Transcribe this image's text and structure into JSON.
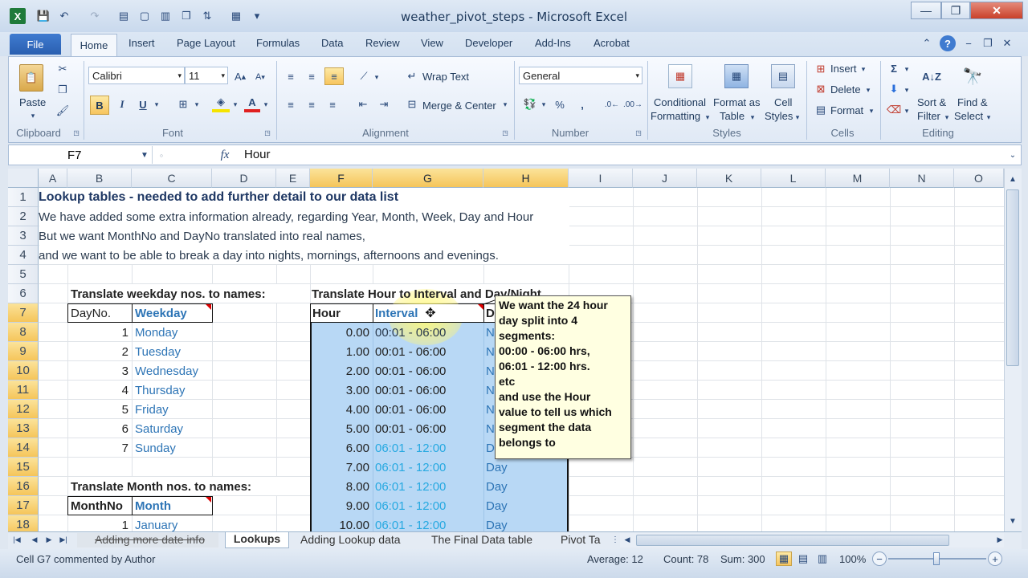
{
  "window": {
    "title": "weather_pivot_steps  -  Microsoft Excel"
  },
  "ribbon": {
    "tabs": [
      "File",
      "Home",
      "Insert",
      "Page Layout",
      "Formulas",
      "Data",
      "Review",
      "View",
      "Developer",
      "Add-Ins",
      "Acrobat"
    ],
    "clipboard": {
      "paste": "Paste",
      "group": "Clipboard"
    },
    "font": {
      "name": "Calibri",
      "size": "11",
      "bold": "B",
      "italic": "I",
      "underline": "U",
      "group": "Font"
    },
    "alignment": {
      "wrap": "Wrap Text",
      "merge": "Merge & Center",
      "group": "Alignment"
    },
    "number": {
      "format": "General",
      "percent": "%",
      "comma": ",",
      "group": "Number"
    },
    "styles": {
      "conditional1": "Conditional",
      "conditional2": "Formatting",
      "format_table1": "Format as",
      "format_table2": "Table",
      "cell_styles1": "Cell",
      "cell_styles2": "Styles",
      "group": "Styles"
    },
    "cells": {
      "insert": "Insert",
      "delete": "Delete",
      "format": "Format",
      "group": "Cells"
    },
    "editing": {
      "sort1": "Sort &",
      "sort2": "Filter",
      "find1": "Find &",
      "find2": "Select",
      "sigma": "Σ",
      "group": "Editing"
    }
  },
  "formula_bar": {
    "name_box": "F7",
    "fx": "fx",
    "content": "Hour"
  },
  "columns": [
    "A",
    "B",
    "C",
    "D",
    "E",
    "F",
    "G",
    "H",
    "I",
    "J",
    "K",
    "L",
    "M",
    "N",
    "O"
  ],
  "rows": [
    "1",
    "2",
    "3",
    "4",
    "5",
    "6",
    "7",
    "8",
    "9",
    "10",
    "11",
    "12",
    "13",
    "14",
    "15",
    "16",
    "17",
    "18"
  ],
  "sheet": {
    "r1": "Lookup tables - needed to add further detail to our data list",
    "r2": "We have added some extra information already, regarding Year, Month, Week, Day and Hour",
    "r3": "But we want MonthNo and DayNo translated into real names,",
    "r4": "and we want to be able to break a day into nights, mornings, afternoons and evenings.",
    "weekday_title": "Translate weekday nos. to names:",
    "dayno_hdr": "DayNo.",
    "weekday_hdr": "Weekday",
    "days": [
      {
        "no": "1",
        "name": "Monday"
      },
      {
        "no": "2",
        "name": "Tuesday"
      },
      {
        "no": "3",
        "name": "Wednesday"
      },
      {
        "no": "4",
        "name": "Thursday"
      },
      {
        "no": "5",
        "name": "Friday"
      },
      {
        "no": "6",
        "name": "Saturday"
      },
      {
        "no": "7",
        "name": "Sunday"
      }
    ],
    "month_title": "Translate Month nos. to names:",
    "monthno_hdr": "MonthNo",
    "month_hdr": "Month",
    "month_first": {
      "no": "1",
      "name": "January"
    },
    "hour_title": "Translate Hour to Interval and Day/Night",
    "hour_hdr": "Hour",
    "interval_hdr": "Interval",
    "daynight_hdr": "D",
    "hours": [
      {
        "hour": "0.00",
        "interval": "00:01 - 06:00",
        "dn": "N"
      },
      {
        "hour": "1.00",
        "interval": "00:01 - 06:00",
        "dn": "N"
      },
      {
        "hour": "2.00",
        "interval": "00:01 - 06:00",
        "dn": "N"
      },
      {
        "hour": "3.00",
        "interval": "00:01 - 06:00",
        "dn": "N"
      },
      {
        "hour": "4.00",
        "interval": "00:01 - 06:00",
        "dn": "N"
      },
      {
        "hour": "5.00",
        "interval": "00:01 - 06:00",
        "dn": "N"
      },
      {
        "hour": "6.00",
        "interval": "06:01 - 12:00",
        "dn": "D"
      },
      {
        "hour": "7.00",
        "interval": "06:01 - 12:00",
        "dn": "Day"
      },
      {
        "hour": "8.00",
        "interval": "06:01 - 12:00",
        "dn": "Day"
      },
      {
        "hour": "9.00",
        "interval": "06:01 - 12:00",
        "dn": "Day"
      },
      {
        "hour": "10.00",
        "interval": "06:01 - 12:00",
        "dn": "Day"
      }
    ]
  },
  "comment": {
    "lines": [
      "We want the 24 hour",
      "day split into 4",
      "segments:",
      "00:00 - 06:00 hrs,",
      "06:01 - 12:00 hrs.",
      "etc",
      "and use the Hour",
      "value to tell us which",
      "segment the data",
      "belongs to"
    ]
  },
  "sheet_tabs": [
    "Adding more date info",
    "Lookups",
    "Adding Lookup data",
    "The Final Data table",
    "Pivot Ta"
  ],
  "status": {
    "left": "Cell G7 commented by Author",
    "average": "Average: 12",
    "count": "Count: 78",
    "sum": "Sum: 300",
    "zoom": "100%"
  }
}
